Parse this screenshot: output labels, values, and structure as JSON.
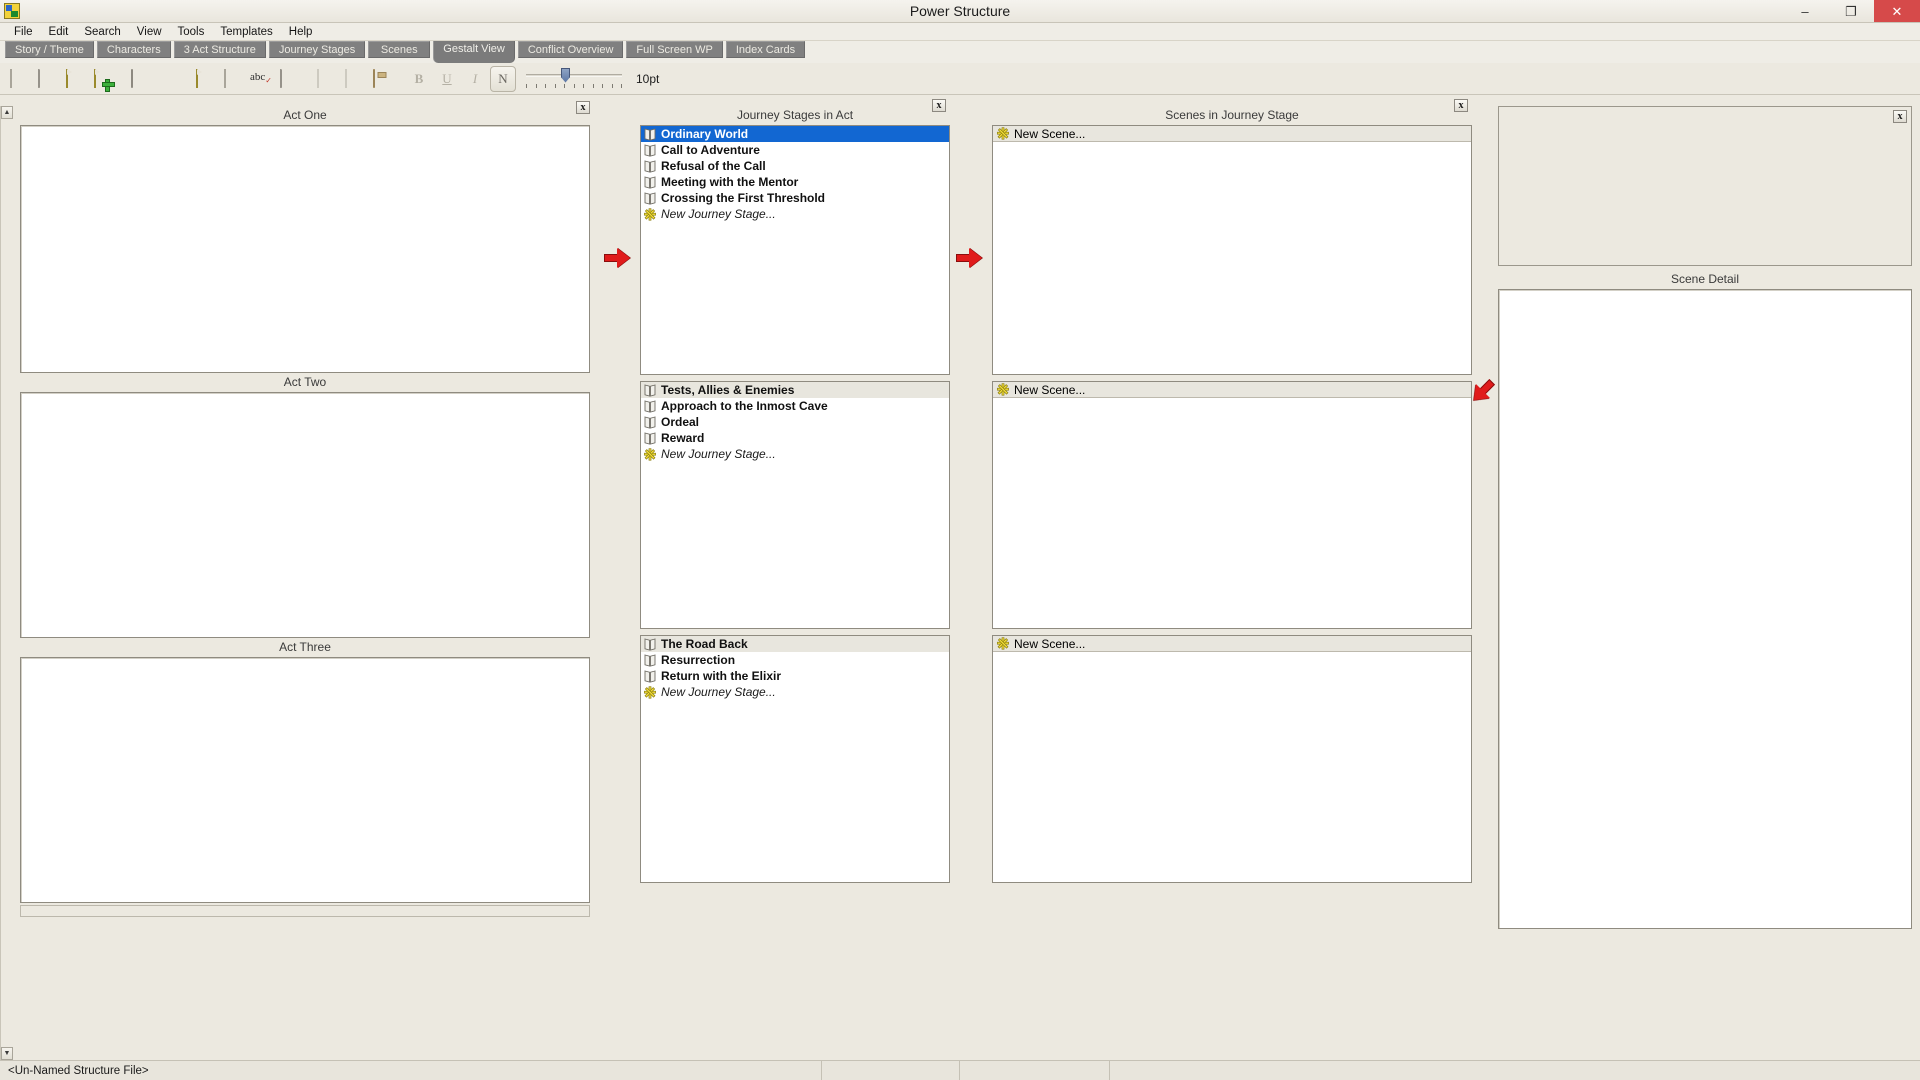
{
  "window": {
    "title": "Power Structure",
    "app_icon": "app-logo-icon",
    "minimize": "–",
    "maximize": "❐",
    "close": "✕"
  },
  "menubar": {
    "items": [
      "File",
      "Edit",
      "Search",
      "View",
      "Tools",
      "Templates",
      "Help"
    ]
  },
  "tabs": [
    {
      "label": "Story / Theme",
      "active": false
    },
    {
      "label": "Characters",
      "active": false
    },
    {
      "label": "3 Act Structure",
      "active": false
    },
    {
      "label": "Journey Stages",
      "active": false
    },
    {
      "label": "Scenes",
      "active": false
    },
    {
      "label": "Gestalt View",
      "active": true
    },
    {
      "label": "Conflict Overview",
      "active": false
    },
    {
      "label": "Full Screen WP",
      "active": false
    },
    {
      "label": "Index Cards",
      "active": false
    }
  ],
  "toolbar": {
    "buttons": [
      "new-document-icon",
      "open-folder-icon",
      "edit-pencil-icon",
      "add-new-icon",
      "print-icon",
      "print-preview-icon",
      "highlight-pencil-icon",
      "notes-page-icon",
      "spellcheck-abc-icon",
      "clipboard-icon",
      "cut-icon",
      "copy-icon",
      "paste-icon"
    ],
    "format": {
      "bold": "B",
      "underline": "U",
      "italic": "I",
      "normal": "N"
    },
    "font_size": "10pt"
  },
  "panels": {
    "acts": {
      "close_label": "x",
      "blocks": [
        {
          "title": "Act One",
          "content": ""
        },
        {
          "title": "Act Two",
          "content": ""
        },
        {
          "title": "Act Three",
          "content": ""
        }
      ]
    },
    "journey_stages": {
      "title": "Journey Stages in Act",
      "close_label": "x",
      "groups": [
        {
          "items": [
            {
              "label": "Ordinary World",
              "icon": "book-icon",
              "selected": true,
              "italic": false
            },
            {
              "label": "Call to Adventure",
              "icon": "book-icon",
              "selected": false,
              "italic": false
            },
            {
              "label": "Refusal of the Call",
              "icon": "book-icon",
              "selected": false,
              "italic": false
            },
            {
              "label": "Meeting with the Mentor",
              "icon": "book-icon",
              "selected": false,
              "italic": false
            },
            {
              "label": "Crossing the First Threshold",
              "icon": "book-icon",
              "selected": false,
              "italic": false
            },
            {
              "label": "New Journey Stage...",
              "icon": "starburst-icon",
              "selected": false,
              "italic": true
            }
          ]
        },
        {
          "items": [
            {
              "label": "Tests, Allies & Enemies",
              "icon": "book-icon",
              "selected": false,
              "italic": false,
              "header": true
            },
            {
              "label": "Approach to the Inmost Cave",
              "icon": "book-icon",
              "selected": false,
              "italic": false
            },
            {
              "label": "Ordeal",
              "icon": "book-icon",
              "selected": false,
              "italic": false
            },
            {
              "label": "Reward",
              "icon": "book-icon",
              "selected": false,
              "italic": false
            },
            {
              "label": "New Journey Stage...",
              "icon": "starburst-icon",
              "selected": false,
              "italic": true
            }
          ]
        },
        {
          "items": [
            {
              "label": "The Road Back",
              "icon": "book-icon",
              "selected": false,
              "italic": false,
              "header": true
            },
            {
              "label": "Resurrection",
              "icon": "book-icon",
              "selected": false,
              "italic": false
            },
            {
              "label": "Return with the Elixir",
              "icon": "book-icon",
              "selected": false,
              "italic": false
            },
            {
              "label": "New Journey Stage...",
              "icon": "starburst-icon",
              "selected": false,
              "italic": true
            }
          ]
        }
      ]
    },
    "scenes": {
      "title": "Scenes in Journey Stage",
      "close_label": "x",
      "groups": [
        {
          "header": {
            "label": "New Scene...",
            "icon": "starburst-icon",
            "italic": true
          }
        },
        {
          "header": {
            "label": "New Scene...",
            "icon": "starburst-icon",
            "italic": true
          }
        },
        {
          "header": {
            "label": "New Scene...",
            "icon": "starburst-icon",
            "italic": true
          }
        }
      ]
    },
    "scene_detail": {
      "close_label": "x",
      "title": "Scene Detail",
      "content": ""
    }
  },
  "connectors": [
    {
      "name": "act-to-stage-arrow",
      "direction": "right"
    },
    {
      "name": "stage-to-scene-arrow",
      "direction": "right"
    },
    {
      "name": "scene-to-detail-arrow",
      "direction": "down-left"
    }
  ],
  "statusbar": {
    "file_label": "<Un-Named Structure File>",
    "cell2": "",
    "cell3": "",
    "cell4": ""
  }
}
